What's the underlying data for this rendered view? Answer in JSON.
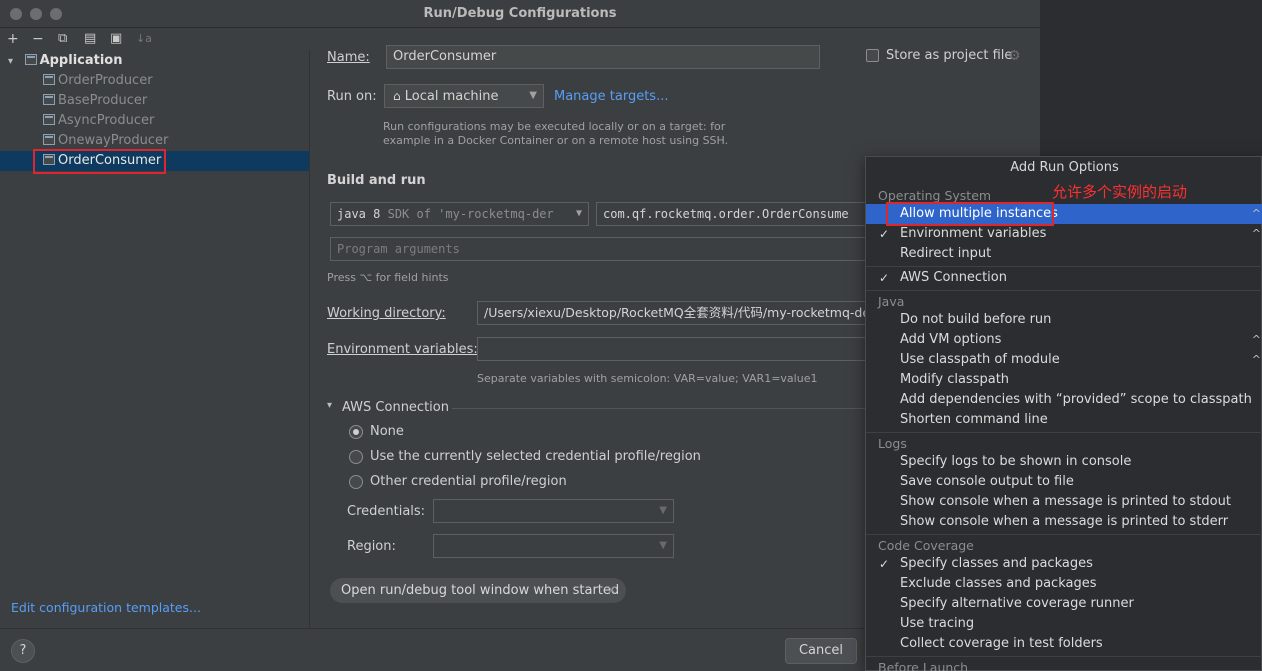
{
  "window": {
    "title": "Run/Debug Configurations"
  },
  "toolbar": {
    "add": "+",
    "remove": "−",
    "copy": "⧉",
    "save": "▤",
    "folder": "▣",
    "sort": "↓a"
  },
  "tree": {
    "root": "Application",
    "items": [
      "OrderProducer",
      "BaseProducer",
      "AsyncProducer",
      "OnewayProducer",
      "OrderConsumer"
    ],
    "selected": "OrderConsumer"
  },
  "edit_templates": "Edit configuration templates...",
  "form": {
    "name_label": "Name:",
    "name_value": "OrderConsumer",
    "store_label": "Store as project file",
    "runon_label": "Run on:",
    "runon_value": "Local machine",
    "manage_targets": "Manage targets...",
    "runon_hint_1": "Run configurations may be executed locally or on a target: for",
    "runon_hint_2": "example in a Docker Container or on a remote host using SSH.",
    "build_run": "Build and run",
    "sdk_value": "java 8",
    "sdk_detail": "SDK of 'my-rocketmq-der",
    "main_class": "com.qf.rocketmq.order.OrderConsume",
    "program_args_placeholder": "Program arguments",
    "field_hints": "Press ⌥ for field hints",
    "workdir_label": "Working directory:",
    "workdir_value": "/Users/xiexu/Desktop/RocketMQ全套资料/代码/my-rocketmq-de",
    "envvars_label": "Environment variables:",
    "envvars_hint": "Separate variables with semicolon: VAR=value; VAR1=value1",
    "aws_section": "AWS Connection",
    "aws_none": "None",
    "aws_current": "Use the currently selected credential profile/region",
    "aws_other": "Other credential profile/region",
    "credentials_label": "Credentials:",
    "region_label": "Region:",
    "tool_window_chip": "Open run/debug tool window when started",
    "chip_close": "×"
  },
  "bottom": {
    "help": "?",
    "cancel": "Cancel"
  },
  "popup": {
    "title": "Add Run Options",
    "annotation": "允许多个实例的启动",
    "groups": [
      {
        "name": "Operating System",
        "options": [
          {
            "label": "Allow multiple instances",
            "checked": false,
            "highlighted": true,
            "shortcut": "^"
          },
          {
            "label": "Environment variables",
            "checked": true,
            "shortcut": "^"
          },
          {
            "label": "Redirect input",
            "checked": false
          }
        ]
      },
      {
        "name": "",
        "options": [
          {
            "label": "AWS Connection",
            "checked": true
          }
        ]
      },
      {
        "name": "Java",
        "options": [
          {
            "label": "Do not build before run",
            "checked": false
          },
          {
            "label": "Add VM options",
            "checked": false,
            "shortcut": "^"
          },
          {
            "label": "Use classpath of module",
            "checked": false,
            "shortcut": "^"
          },
          {
            "label": "Modify classpath",
            "checked": false
          },
          {
            "label": "Add dependencies with “provided” scope to classpath",
            "checked": false
          },
          {
            "label": "Shorten command line",
            "checked": false
          }
        ]
      },
      {
        "name": "Logs",
        "options": [
          {
            "label": "Specify logs to be shown in console",
            "checked": false
          },
          {
            "label": "Save console output to file",
            "checked": false
          },
          {
            "label": "Show console when a message is printed to stdout",
            "checked": false
          },
          {
            "label": "Show console when a message is printed to stderr",
            "checked": false
          }
        ]
      },
      {
        "name": "Code Coverage",
        "options": [
          {
            "label": "Specify classes and packages",
            "checked": true
          },
          {
            "label": "Exclude classes and packages",
            "checked": false
          },
          {
            "label": "Specify alternative coverage runner",
            "checked": false
          },
          {
            "label": "Use tracing",
            "checked": false
          },
          {
            "label": "Collect coverage in test folders",
            "checked": false
          }
        ]
      },
      {
        "name": "Before Launch",
        "options": []
      }
    ]
  }
}
